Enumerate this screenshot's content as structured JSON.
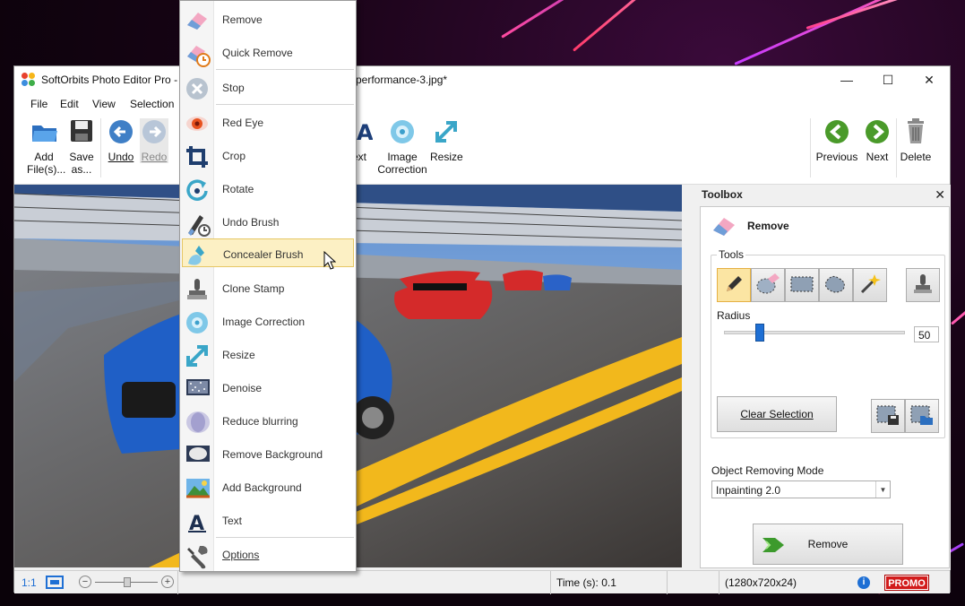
{
  "window": {
    "title_left": "SoftOrbits Photo Editor Pro -",
    "title_right": "performance-3.jpg*",
    "controls": {
      "minimize": "—",
      "maximize": "☐",
      "close": "✕"
    }
  },
  "menu": {
    "file": "File",
    "edit": "Edit",
    "view": "View",
    "selection": "Selection"
  },
  "toolbar": {
    "add_files_l1": "Add",
    "add_files_l2": "File(s)...",
    "save_l1": "Save",
    "save_l2": "as...",
    "undo": "Undo",
    "redo": "Redo",
    "text_partial": "ext",
    "image_correction_l1": "Image",
    "image_correction_l2": "Correction",
    "resize": "Resize",
    "previous": "Previous",
    "next": "Next",
    "delete": "Delete"
  },
  "context_menu": {
    "items": [
      {
        "label": "Remove",
        "icon": "eraser-icon"
      },
      {
        "label": "Quick Remove",
        "icon": "quick-remove-icon"
      },
      {
        "label": "Stop",
        "icon": "stop-icon"
      },
      {
        "label": "Red Eye",
        "icon": "red-eye-icon"
      },
      {
        "label": "Crop",
        "icon": "crop-icon"
      },
      {
        "label": "Rotate",
        "icon": "rotate-icon"
      },
      {
        "label": "Undo Brush",
        "icon": "undo-brush-icon"
      },
      {
        "label": "Concealer Brush",
        "icon": "concealer-brush-icon"
      },
      {
        "label": "Clone Stamp",
        "icon": "clone-stamp-icon"
      },
      {
        "label": "Image Correction",
        "icon": "image-correction-icon"
      },
      {
        "label": "Resize",
        "icon": "resize-icon"
      },
      {
        "label": "Denoise",
        "icon": "denoise-icon"
      },
      {
        "label": "Reduce blurring",
        "icon": "reduce-blur-icon"
      },
      {
        "label": "Remove Background",
        "icon": "remove-background-icon"
      },
      {
        "label": "Add Background",
        "icon": "add-background-icon"
      },
      {
        "label": "Text",
        "icon": "text-icon"
      },
      {
        "label": "Options",
        "icon": "options-icon"
      }
    ],
    "highlighted": "Concealer Brush"
  },
  "toolbox": {
    "header": "Toolbox",
    "close": "✕",
    "mode_title": "Remove",
    "tools_label": "Tools",
    "radius_label": "Radius",
    "radius_value": "50",
    "radius_fraction": 0.18,
    "clear_selection": "Clear Selection",
    "object_mode_label": "Object Removing Mode",
    "object_mode_value": "Inpainting 2.0",
    "remove_button": "Remove"
  },
  "status": {
    "zoom_ratio": "1:1",
    "time": "Time (s): 0.1",
    "dimensions": "(1280x720x24)",
    "promo": "PROMO"
  },
  "colors": {
    "accent_yellow": "#fbe5a3",
    "promo_red": "#d21b1b",
    "nav_green": "#4a9a2a",
    "toolbar_blue": "#3f7fc6"
  }
}
